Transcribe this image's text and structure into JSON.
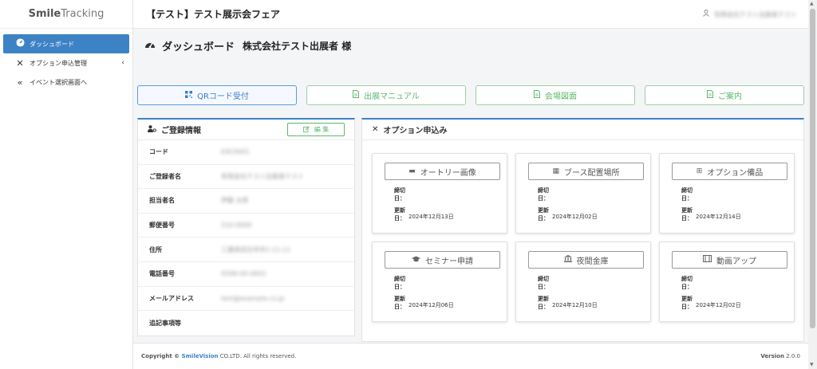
{
  "brand": {
    "part1": "Smile",
    "part2": "Tracking"
  },
  "sidebar": {
    "items": [
      {
        "label": "ダッシュボード",
        "icon": "dashboard-icon",
        "active": true
      },
      {
        "label": "オプション申込管理",
        "icon": "tools-icon",
        "chevron": "‹"
      },
      {
        "label": "イベント選択画面へ",
        "icon": "double-chevron-left-icon"
      }
    ]
  },
  "topbar": {
    "title": "【テスト】テスト展示会フェア",
    "user_name": "有限会社テスト出展者テスト"
  },
  "page": {
    "title": "ダッシュボード",
    "company": "株式会社テスト出展者 様"
  },
  "buttons": [
    {
      "label": "QRコード受付",
      "icon": "qr-icon"
    },
    {
      "label": "出展マニュアル",
      "icon": "file-icon"
    },
    {
      "label": "会場図面",
      "icon": "file-icon"
    },
    {
      "label": "ご案内",
      "icon": "file-icon"
    }
  ],
  "registration": {
    "title": "ご登録情報",
    "edit_label": "編 集",
    "rows": [
      {
        "key": "コード",
        "value": "EXC0001"
      },
      {
        "key": "ご登録者名",
        "value": "有限会社テスト出展者テスト"
      },
      {
        "key": "担当者名",
        "value": "伊藤 太郎"
      },
      {
        "key": "郵便番号",
        "value": "510-0000"
      },
      {
        "key": "住所",
        "value": "三重県四日市市1-11-11"
      },
      {
        "key": "電話番号",
        "value": "0598-00-0002"
      },
      {
        "key": "メールアドレス",
        "value": "test@example.co.jp"
      },
      {
        "key": "追記事項等",
        "value": ""
      }
    ]
  },
  "options": {
    "title": "オプション申込み",
    "deadline_label_1": "締切",
    "deadline_label_2": "日：",
    "updated_label_1": "更新",
    "updated_label_2": "日：",
    "cards": [
      {
        "label": "オートリー画像",
        "icon": "box-icon",
        "updated": "2024年12月13日"
      },
      {
        "label": "ブース配置場所",
        "icon": "booth-icon",
        "updated": "2024年12月02日"
      },
      {
        "label": "オプション備品",
        "icon": "plus-square-icon",
        "updated": "2024年12月14日"
      },
      {
        "label": "セミナー申請",
        "icon": "graduation-cap-icon",
        "updated": "2024年12月06日"
      },
      {
        "label": "夜間金庫",
        "icon": "bank-icon",
        "updated": "2024年12月10日"
      },
      {
        "label": "動画アップ",
        "icon": "film-icon",
        "updated": "2024年12月02日"
      }
    ]
  },
  "footer": {
    "copy_prefix": "Copyright © ",
    "copy_brand": "SmileVision",
    "copy_suffix": " CO.LTD. All rights reserved.",
    "version_label": "Version",
    "version_value": " 2.0.0"
  },
  "colors": {
    "accent": "#3d82c4",
    "success": "#5cb86c"
  }
}
